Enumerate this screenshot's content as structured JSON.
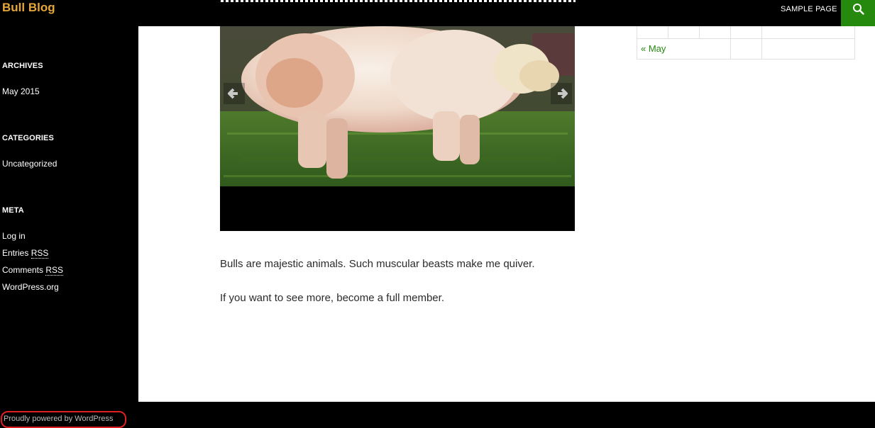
{
  "header": {
    "site_title": "Bull Blog",
    "nav": {
      "sample_page": "SAMPLE PAGE"
    },
    "search_icon": "search-icon",
    "accent": "#24890d",
    "title_color": "#e5a63a"
  },
  "sidebar": {
    "archives": {
      "title": "ARCHIVES",
      "items": [
        "May 2015"
      ]
    },
    "categories": {
      "title": "CATEGORIES",
      "items": [
        "Uncategorized"
      ]
    },
    "meta": {
      "title": "META",
      "log_in": "Log in",
      "entries": "Entries",
      "comments": "Comments",
      "rss": "RSS",
      "wordpress_org": "WordPress.org"
    }
  },
  "post": {
    "gallery": {
      "prev_icon": "arrow-left-icon",
      "next_icon": "arrow-right-icon"
    },
    "paragraphs": [
      "Bulls are majestic animals. Such muscular beasts make me quiver.",
      "If you want to see more, become a full member."
    ]
  },
  "calendar": {
    "prev_link": "« May"
  },
  "footer": {
    "credit": "Proudly powered by WordPress"
  }
}
